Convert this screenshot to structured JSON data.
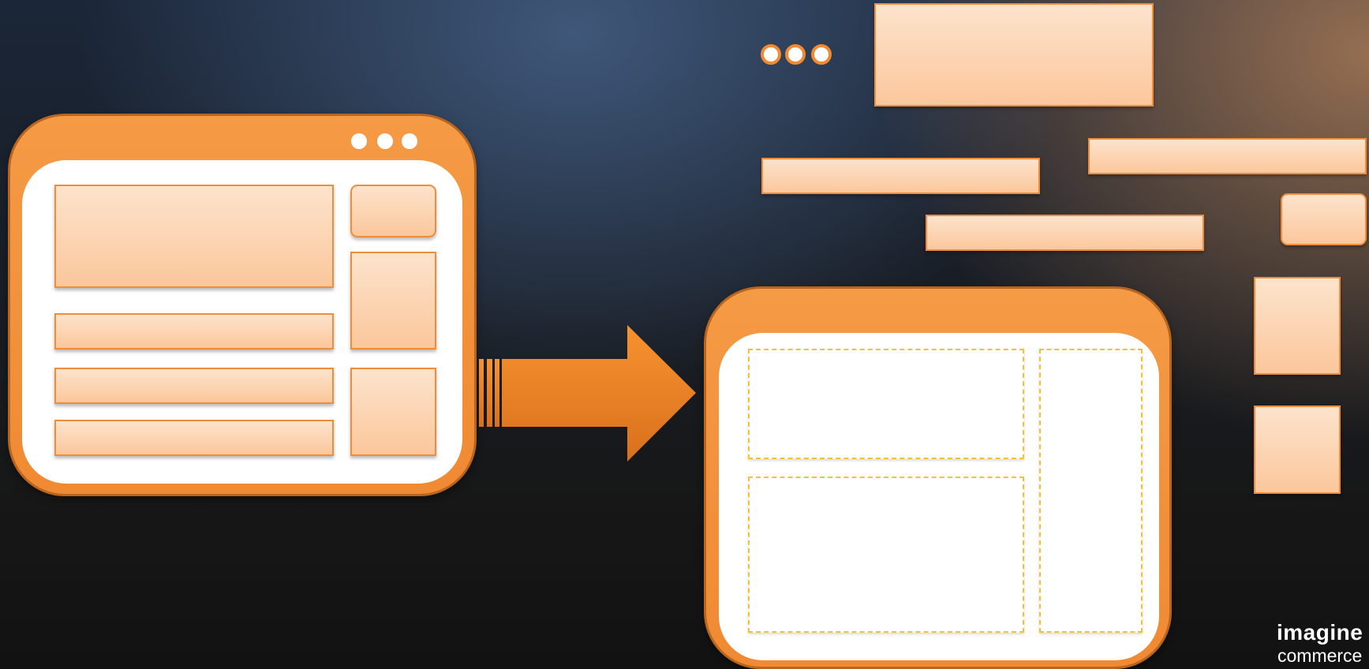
{
  "colors": {
    "window_frame": "#f08a33",
    "box_border": "#ef8d3a",
    "box_fill": "#fde3cc",
    "slot_dash": "#f2c232",
    "arrow": "#f28a30"
  },
  "icons": [
    "window-control-dots",
    "arrow-right",
    "loose-control-dots"
  ],
  "logo": {
    "line1": "imagine",
    "line2": "commerce"
  }
}
